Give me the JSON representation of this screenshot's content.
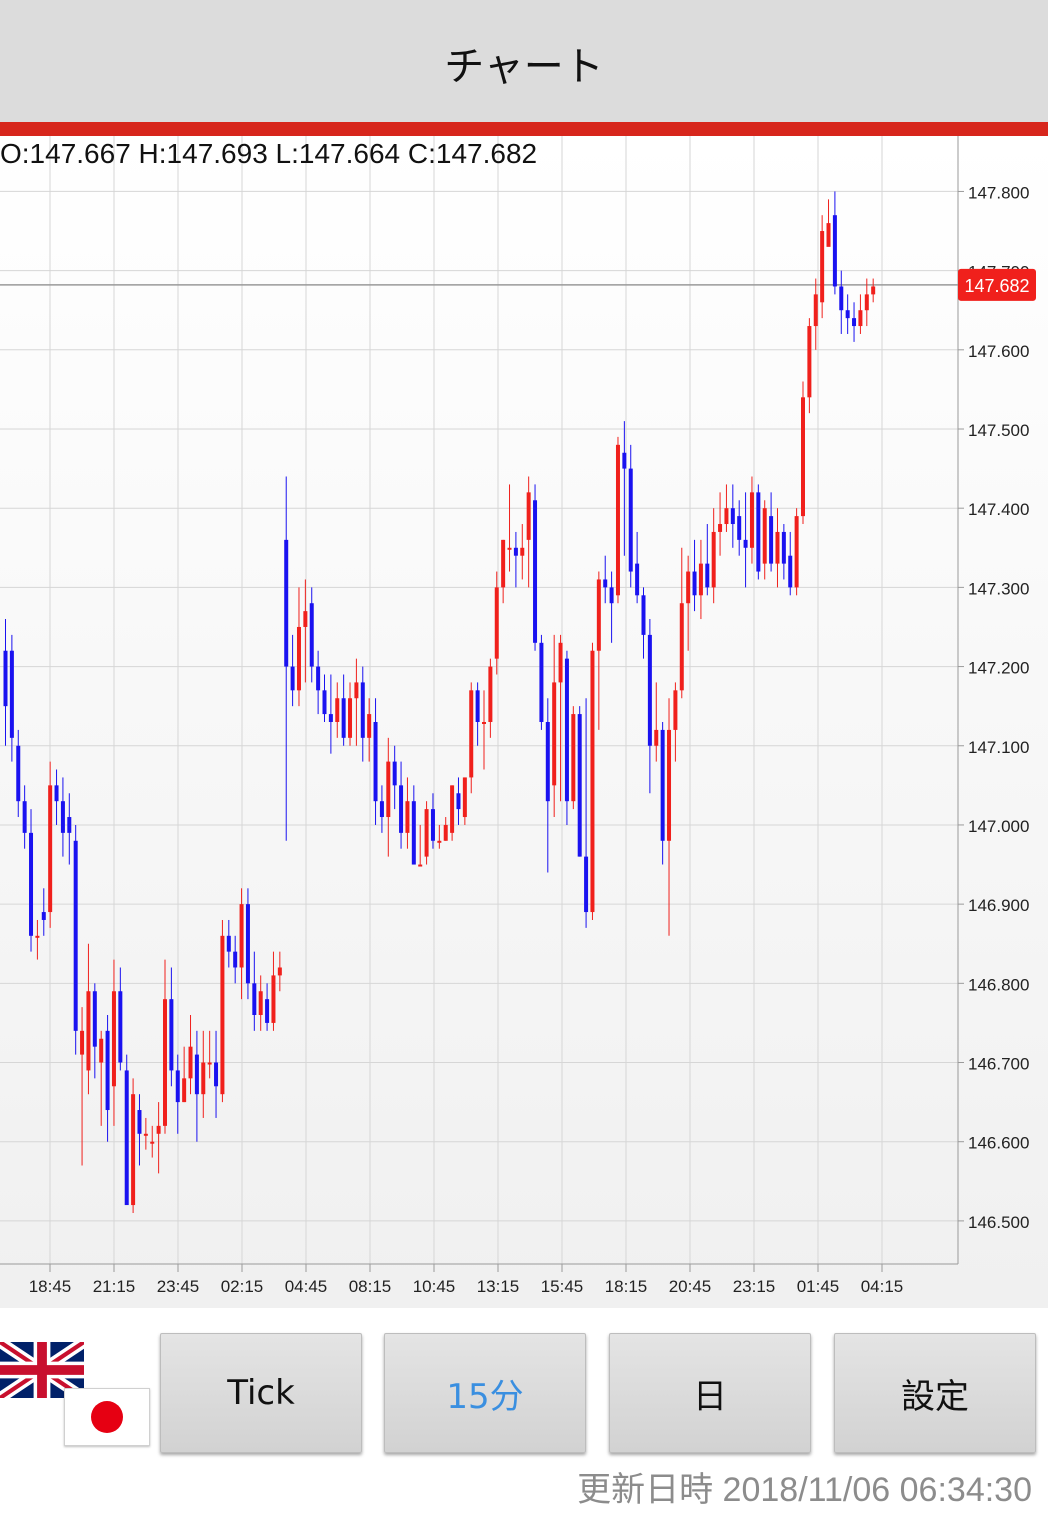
{
  "header": {
    "title": "チャート"
  },
  "ohlc": {
    "text": "O:147.667 H:147.693 L:147.664 C:147.682"
  },
  "colors": {
    "up": "#f0201c",
    "down": "#1a12f0",
    "accent": "#d7261c",
    "active_button": "#3a8fe0",
    "last_price_label": "#f0201c"
  },
  "chart_data": {
    "type": "candlestick",
    "y_ticks": [
      "146.500",
      "146.600",
      "146.700",
      "146.800",
      "146.900",
      "147.000",
      "147.100",
      "147.200",
      "147.300",
      "147.400",
      "147.500",
      "147.600",
      "147.700",
      "147.800"
    ],
    "ylim": [
      146.39,
      147.87
    ],
    "x_ticks": [
      "18:45",
      "21:15",
      "23:45",
      "02:15",
      "04:45",
      "08:15",
      "10:45",
      "13:15",
      "15:45",
      "18:15",
      "20:45",
      "23:15",
      "01:45",
      "04:15"
    ],
    "last_price": "147.682",
    "grid": true,
    "candles": [
      [
        147.22,
        147.15,
        147.26,
        147.1
      ],
      [
        147.22,
        147.11,
        147.24,
        147.08
      ],
      [
        147.1,
        147.03,
        147.12,
        147.01
      ],
      [
        147.03,
        146.99,
        147.05,
        146.97
      ],
      [
        146.99,
        146.86,
        147.02,
        146.84
      ],
      [
        146.86,
        146.86,
        146.88,
        146.83
      ],
      [
        146.89,
        146.88,
        146.92,
        146.86
      ],
      [
        146.89,
        147.05,
        147.08,
        146.87
      ],
      [
        147.05,
        147.03,
        147.07,
        147.0
      ],
      [
        147.03,
        146.99,
        147.06,
        146.96
      ],
      [
        147.01,
        146.99,
        147.04,
        146.95
      ],
      [
        146.98,
        146.74,
        147.0,
        146.71
      ],
      [
        146.71,
        146.74,
        146.77,
        146.57
      ],
      [
        146.69,
        146.79,
        146.85,
        146.66
      ],
      [
        146.79,
        146.72,
        146.8,
        146.68
      ],
      [
        146.7,
        146.73,
        146.74,
        146.62
      ],
      [
        146.74,
        146.64,
        146.76,
        146.6
      ],
      [
        146.67,
        146.79,
        146.83,
        146.62
      ],
      [
        146.79,
        146.7,
        146.82,
        146.69
      ],
      [
        146.69,
        146.52,
        146.71,
        146.52
      ],
      [
        146.52,
        146.66,
        146.68,
        146.51
      ],
      [
        146.64,
        146.61,
        146.66,
        146.57
      ],
      [
        146.61,
        146.61,
        146.63,
        146.59
      ],
      [
        146.6,
        146.6,
        146.62,
        146.58
      ],
      [
        146.61,
        146.62,
        146.65,
        146.56
      ],
      [
        146.62,
        146.78,
        146.83,
        146.61
      ],
      [
        146.78,
        146.69,
        146.82,
        146.67
      ],
      [
        146.69,
        146.65,
        146.71,
        146.61
      ],
      [
        146.65,
        146.68,
        146.72,
        146.65
      ],
      [
        146.68,
        146.72,
        146.76,
        146.66
      ],
      [
        146.71,
        146.66,
        146.74,
        146.6
      ],
      [
        146.66,
        146.7,
        146.74,
        146.63
      ],
      [
        146.7,
        146.7,
        146.74,
        146.68
      ],
      [
        146.7,
        146.67,
        146.74,
        146.63
      ],
      [
        146.66,
        146.86,
        146.88,
        146.65
      ],
      [
        146.86,
        146.84,
        146.88,
        146.82
      ],
      [
        146.84,
        146.82,
        146.86,
        146.8
      ],
      [
        146.82,
        146.9,
        146.92,
        146.78
      ],
      [
        146.9,
        146.8,
        146.92,
        146.78
      ],
      [
        146.8,
        146.76,
        146.84,
        146.74
      ],
      [
        146.76,
        146.79,
        146.81,
        146.74
      ],
      [
        146.78,
        146.75,
        146.8,
        146.74
      ],
      [
        146.75,
        146.81,
        146.84,
        146.74
      ],
      [
        146.81,
        146.82,
        146.84,
        146.79
      ],
      [
        147.36,
        147.2,
        147.44,
        146.98
      ],
      [
        147.2,
        147.17,
        147.24,
        147.15
      ],
      [
        147.17,
        147.25,
        147.3,
        147.15
      ],
      [
        147.25,
        147.27,
        147.31,
        147.18
      ],
      [
        147.28,
        147.2,
        147.3,
        147.18
      ],
      [
        147.2,
        147.17,
        147.22,
        147.14
      ],
      [
        147.17,
        147.14,
        147.19,
        147.13
      ],
      [
        147.14,
        147.13,
        147.19,
        147.09
      ],
      [
        147.13,
        147.16,
        147.18,
        147.11
      ],
      [
        147.16,
        147.11,
        147.19,
        147.1
      ],
      [
        147.11,
        147.16,
        147.18,
        147.1
      ],
      [
        147.16,
        147.18,
        147.21,
        147.1
      ],
      [
        147.18,
        147.11,
        147.2,
        147.08
      ],
      [
        147.11,
        147.14,
        147.16,
        147.08
      ],
      [
        147.13,
        147.03,
        147.16,
        147.0
      ],
      [
        147.03,
        147.01,
        147.05,
        146.99
      ],
      [
        147.01,
        147.08,
        147.11,
        146.96
      ],
      [
        147.08,
        147.05,
        147.1,
        147.02
      ],
      [
        147.05,
        146.99,
        147.08,
        146.97
      ],
      [
        146.99,
        147.03,
        147.06,
        146.97
      ],
      [
        147.03,
        146.95,
        147.05,
        146.95
      ],
      [
        146.95,
        146.95,
        147.0,
        146.95
      ],
      [
        146.96,
        147.02,
        147.03,
        146.95
      ],
      [
        147.02,
        146.98,
        147.04,
        146.97
      ],
      [
        146.98,
        146.98,
        147.0,
        146.97
      ],
      [
        146.98,
        147.0,
        147.01,
        146.98
      ],
      [
        146.99,
        147.05,
        147.05,
        146.98
      ],
      [
        147.04,
        147.02,
        147.06,
        147.0
      ],
      [
        147.01,
        147.06,
        147.06,
        147.0
      ],
      [
        147.06,
        147.17,
        147.18,
        147.04
      ],
      [
        147.17,
        147.13,
        147.18,
        147.1
      ],
      [
        147.13,
        147.13,
        147.17,
        147.07
      ],
      [
        147.13,
        147.2,
        147.21,
        147.11
      ],
      [
        147.21,
        147.3,
        147.32,
        147.19
      ],
      [
        147.3,
        147.36,
        147.36,
        147.28
      ],
      [
        147.35,
        147.35,
        147.43,
        147.32
      ],
      [
        147.35,
        147.34,
        147.37,
        147.3
      ],
      [
        147.34,
        147.35,
        147.38,
        147.31
      ],
      [
        147.36,
        147.42,
        147.44,
        147.3
      ],
      [
        147.41,
        147.23,
        147.43,
        147.22
      ],
      [
        147.23,
        147.13,
        147.24,
        147.12
      ],
      [
        147.13,
        147.03,
        147.16,
        146.94
      ],
      [
        147.05,
        147.18,
        147.24,
        147.01
      ],
      [
        147.18,
        147.23,
        147.24,
        147.03
      ],
      [
        147.21,
        147.03,
        147.22,
        147.0
      ],
      [
        147.03,
        147.14,
        147.15,
        147.02
      ],
      [
        147.14,
        146.96,
        147.15,
        146.96
      ],
      [
        146.96,
        146.89,
        147.16,
        146.87
      ],
      [
        146.89,
        147.22,
        147.23,
        146.88
      ],
      [
        147.22,
        147.31,
        147.32,
        147.12
      ],
      [
        147.31,
        147.3,
        147.34,
        147.28
      ],
      [
        147.3,
        147.28,
        147.32,
        147.23
      ],
      [
        147.29,
        147.48,
        147.49,
        147.28
      ],
      [
        147.47,
        147.45,
        147.51,
        147.34
      ],
      [
        147.45,
        147.32,
        147.48,
        147.3
      ],
      [
        147.33,
        147.29,
        147.37,
        147.28
      ],
      [
        147.29,
        147.24,
        147.3,
        147.21
      ],
      [
        147.24,
        147.1,
        147.26,
        147.04
      ],
      [
        147.1,
        147.12,
        147.18,
        147.08
      ],
      [
        147.12,
        146.98,
        147.13,
        146.95
      ],
      [
        146.98,
        147.12,
        147.16,
        146.86
      ],
      [
        147.12,
        147.17,
        147.18,
        147.08
      ],
      [
        147.17,
        147.28,
        147.35,
        147.16
      ],
      [
        147.28,
        147.32,
        147.34,
        147.22
      ],
      [
        147.32,
        147.29,
        147.36,
        147.27
      ],
      [
        147.29,
        147.33,
        147.36,
        147.26
      ],
      [
        147.33,
        147.3,
        147.38,
        147.29
      ],
      [
        147.3,
        147.37,
        147.4,
        147.28
      ],
      [
        147.37,
        147.38,
        147.42,
        147.34
      ],
      [
        147.38,
        147.4,
        147.43,
        147.37
      ],
      [
        147.4,
        147.38,
        147.43,
        147.35
      ],
      [
        147.39,
        147.36,
        147.41,
        147.34
      ],
      [
        147.36,
        147.35,
        147.42,
        147.3
      ],
      [
        147.35,
        147.42,
        147.44,
        147.33
      ],
      [
        147.42,
        147.32,
        147.43,
        147.31
      ],
      [
        147.33,
        147.4,
        147.41,
        147.31
      ],
      [
        147.39,
        147.33,
        147.42,
        147.32
      ],
      [
        147.33,
        147.37,
        147.4,
        147.3
      ],
      [
        147.37,
        147.33,
        147.38,
        147.31
      ],
      [
        147.34,
        147.3,
        147.37,
        147.29
      ],
      [
        147.3,
        147.39,
        147.4,
        147.29
      ],
      [
        147.39,
        147.54,
        147.56,
        147.38
      ],
      [
        147.54,
        147.63,
        147.64,
        147.52
      ],
      [
        147.63,
        147.67,
        147.69,
        147.6
      ],
      [
        147.66,
        147.75,
        147.77,
        147.64
      ],
      [
        147.73,
        147.76,
        147.79,
        147.74
      ],
      [
        147.77,
        147.68,
        147.8,
        147.67
      ],
      [
        147.68,
        147.65,
        147.7,
        147.62
      ],
      [
        147.65,
        147.64,
        147.67,
        147.62
      ],
      [
        147.64,
        147.63,
        147.66,
        147.61
      ],
      [
        147.63,
        147.65,
        147.67,
        147.62
      ],
      [
        147.65,
        147.67,
        147.69,
        147.63
      ],
      [
        147.67,
        147.68,
        147.69,
        147.66
      ]
    ]
  },
  "buttons": {
    "tick": "Tick",
    "m15": "15分",
    "day": "日",
    "settings": "設定"
  },
  "footer": {
    "updated": "更新日時  2018/11/06 06:34:30"
  }
}
